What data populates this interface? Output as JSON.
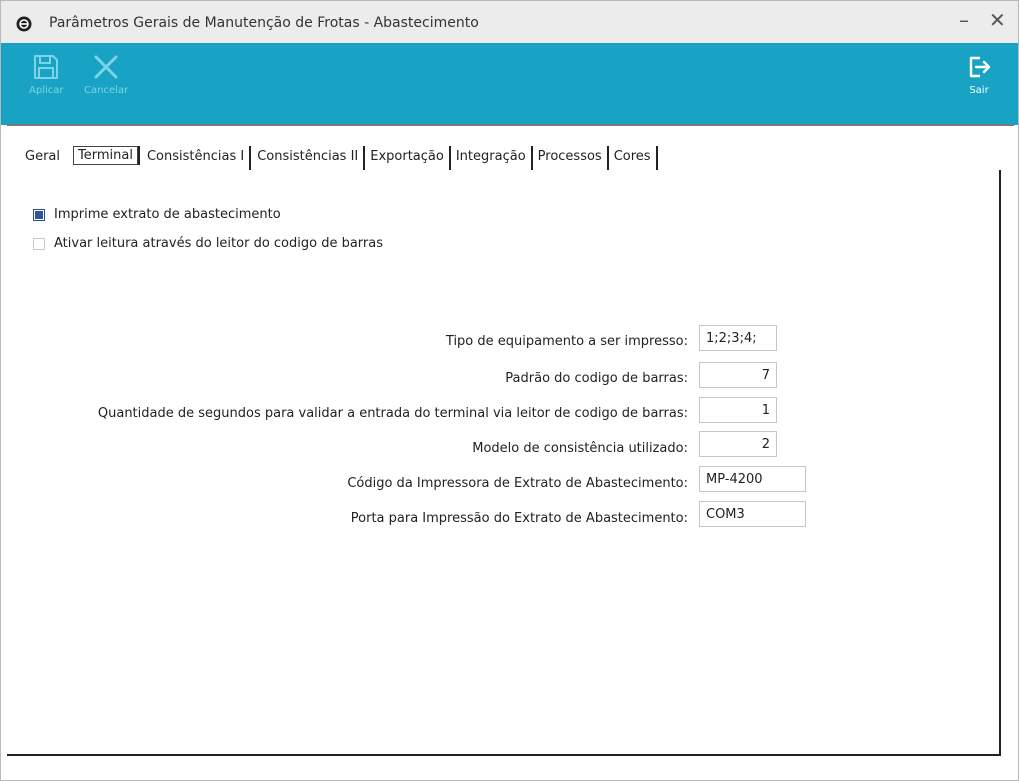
{
  "window": {
    "title": "Parâmetros Gerais de Manutenção de Frotas - Abastecimento",
    "minimize": "–",
    "close": "✕"
  },
  "toolbar": {
    "apply_label": "Aplicar",
    "cancel_label": "Cancelar",
    "exit_label": "Sair",
    "accent_color": "#18a3c5"
  },
  "tabs": [
    {
      "label": "Geral"
    },
    {
      "label": "Terminal"
    },
    {
      "label": "Consistências I"
    },
    {
      "label": "Consistências II"
    },
    {
      "label": "Exportação"
    },
    {
      "label": "Integração"
    },
    {
      "label": "Processos"
    },
    {
      "label": "Cores"
    }
  ],
  "active_tab": "Terminal",
  "checkboxes": [
    {
      "label": "Imprime extrato de abastecimento",
      "checked": true
    },
    {
      "label": "Ativar leitura através do leitor do codigo de barras",
      "checked": false
    }
  ],
  "fields": [
    {
      "label": "Tipo de equipamento a ser impresso:",
      "value": "1;2;3;4;"
    },
    {
      "label": "Padrão do codigo de barras:",
      "value": "7"
    },
    {
      "label": "Quantidade de segundos para validar a entrada do terminal via leitor de codigo de barras:",
      "value": "1"
    },
    {
      "label": "Modelo de consistência utilizado:",
      "value": "2"
    },
    {
      "label": "Código da Impressora de Extrato de Abastecimento:",
      "value": "MP-4200"
    },
    {
      "label": "Porta para Impressão do Extrato de Abastecimento:",
      "value": "COM3"
    }
  ]
}
